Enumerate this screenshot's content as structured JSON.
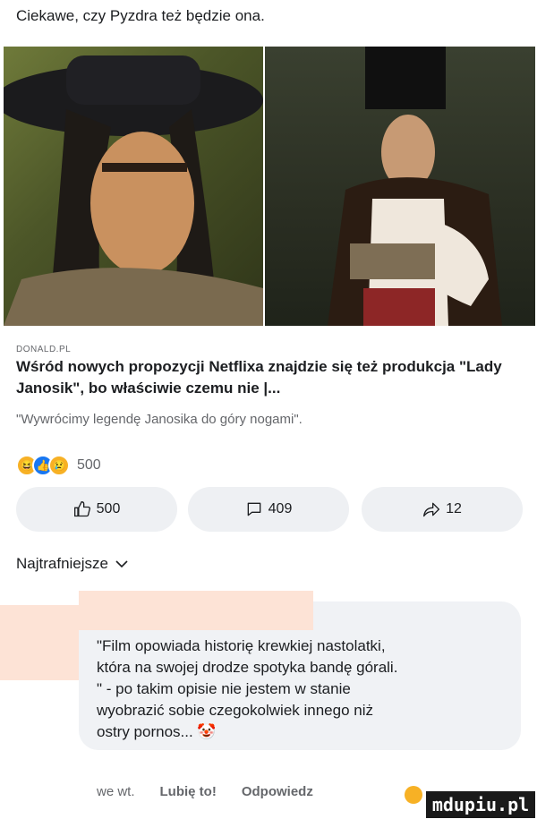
{
  "post": {
    "caption": "Ciekawe, czy Pyzdra też będzie ona."
  },
  "link": {
    "source": "DONALD.PL",
    "headline": "Wśród nowych propozycji Netflixa znajdzie się też produkcja \"Lady Janosik\", bo właściwie czemu nie |...",
    "subline": "\"Wywrócimy legendę Janosika do góry nogami\"."
  },
  "reactions": {
    "count": "500",
    "icons": [
      "haha-icon",
      "like-icon",
      "sad-icon"
    ]
  },
  "actions": {
    "like_count": "500",
    "comment_count": "409",
    "share_count": "12"
  },
  "sort": {
    "label": "Najtrafniejsze"
  },
  "comment": {
    "text": "\"Film opowiada historię krewkiej nastolatki,\nktóra na swojej drodze spotyka bandę górali.\n\" - po takim opisie nie jestem w stanie\nwyobrazić sobie czegokolwiek innego niż\nostry pornos... 🤡",
    "time": "we wt.",
    "like_label": "Lubię to!",
    "reply_label": "Odpowiedz"
  },
  "watermark": "mdupiu.pl",
  "colors": {
    "accent": "#1877f2",
    "bubble": "#f0f2f5",
    "button": "#eef0f3",
    "redaction": "#fde3d6"
  }
}
